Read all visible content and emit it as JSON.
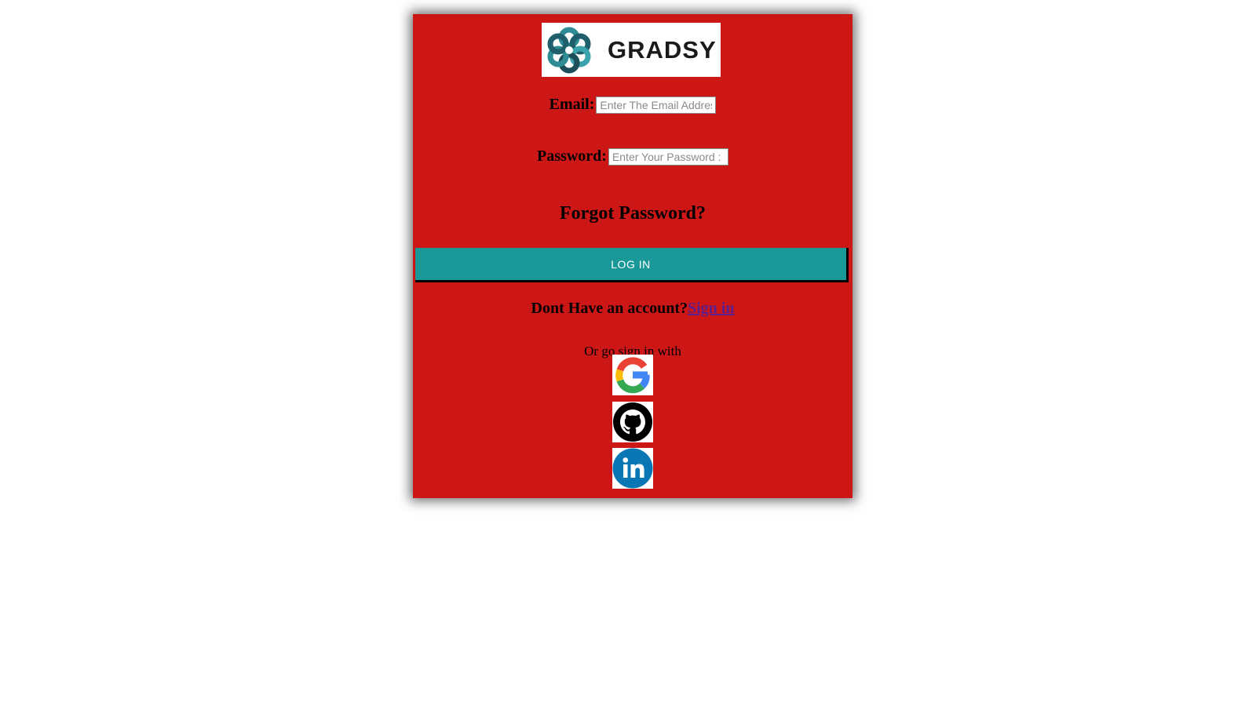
{
  "logo": {
    "text": "GRADSY",
    "icon": "gradsy-knot-logo-icon"
  },
  "form": {
    "email_label": "Email:",
    "email_placeholder": "Enter The Email Address",
    "email_value": "",
    "password_label": "Password:",
    "password_placeholder": "Enter Your Password :",
    "password_value": "",
    "forgot_label": "Forgot Password?",
    "login_label": "LOG IN"
  },
  "signup": {
    "prompt": "Dont Have an account?",
    "link": "Sign in"
  },
  "social": {
    "intro": "Or go sign in with",
    "providers": [
      {
        "name": "google",
        "icon": "google-icon"
      },
      {
        "name": "github",
        "icon": "github-icon"
      },
      {
        "name": "linkedin",
        "icon": "linkedin-icon"
      }
    ]
  },
  "colors": {
    "card_background": "#cc1716",
    "button_background": "#1a9898",
    "link": "#5b1f8f"
  }
}
